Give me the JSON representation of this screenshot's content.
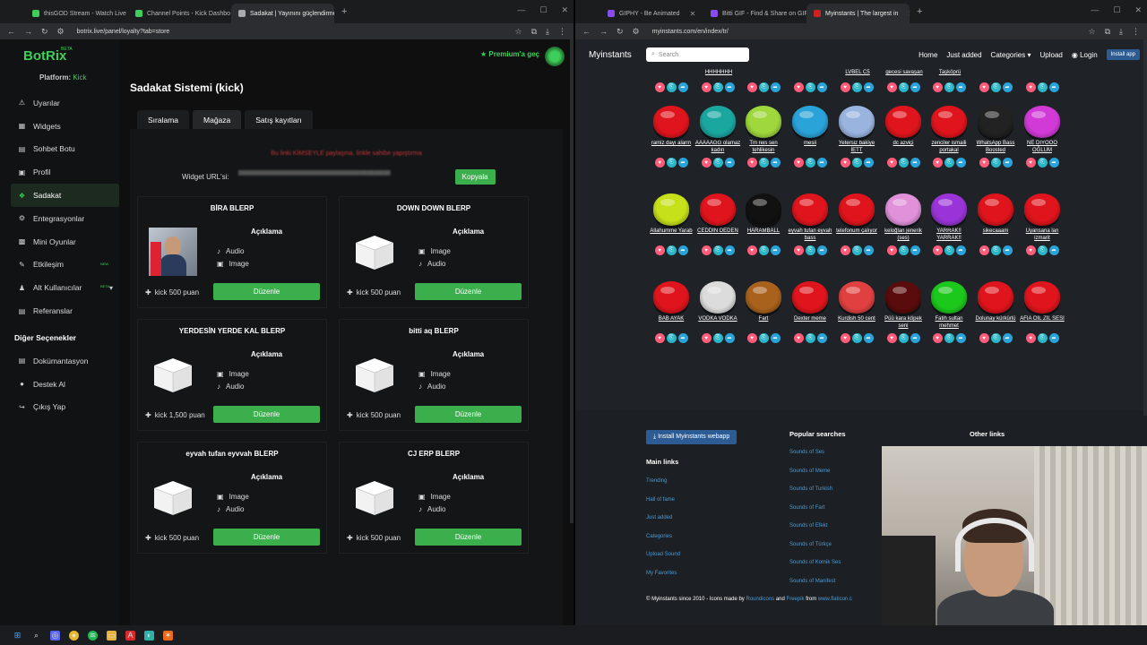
{
  "left_browser": {
    "tabs": [
      {
        "label": "thisGOD Stream - Watch Live o",
        "icon_color": "#3ecf5a"
      },
      {
        "label": "Channel Points - Kick Dashbo",
        "icon_color": "#3ecf5a"
      },
      {
        "label": "Sadakat | Yayınını güçlendirme",
        "icon_color": "#aaaaaa"
      }
    ],
    "url": "botrix.live/panel/loyalty?tab=store"
  },
  "right_browser": {
    "tabs": [
      {
        "label": "GIPHY - Be Animated",
        "icon_color": "#8a4cf0"
      },
      {
        "label": "Bitti GIF - Find & Share on GIF",
        "icon_color": "#8a4cf0"
      },
      {
        "label": "Myinstants | The largest in",
        "icon_color": "#cc2222"
      }
    ],
    "url": "myinstants.com/en/index/tr/"
  },
  "botrix": {
    "logo": "BotRix",
    "beta": "BETA",
    "platform_label": "Platform:",
    "platform_value": "Kick",
    "premium": "Premium'a geç",
    "nav": [
      {
        "label": "Uyarılar",
        "icon": "warning-icon"
      },
      {
        "label": "Widgets",
        "icon": "widgets-icon"
      },
      {
        "label": "Sohbet Botu",
        "icon": "chat-icon"
      },
      {
        "label": "Profil",
        "icon": "profile-icon"
      },
      {
        "label": "Sadakat",
        "icon": "loyalty-icon",
        "active": true
      },
      {
        "label": "Entegrasyonlar",
        "icon": "integrations-icon"
      },
      {
        "label": "Mini Oyunlar",
        "icon": "games-icon"
      },
      {
        "label": "Etkileşim",
        "icon": "interaction-icon",
        "badge": "NEW"
      },
      {
        "label": "Alt Kullanıcılar",
        "icon": "subusers-icon",
        "badge": "BETA"
      },
      {
        "label": "Referanslar",
        "icon": "referrals-icon"
      }
    ],
    "other_head": "Diğer Seçenekler",
    "other": [
      {
        "label": "Dokümantasyon",
        "icon": "docs-icon"
      },
      {
        "label": "Destek Al",
        "icon": "support-icon"
      },
      {
        "label": "Çıkış Yap",
        "icon": "logout-icon"
      }
    ],
    "title": "Sadakat Sistemi (kick)",
    "tabs": [
      "Sıralama",
      "Mağaza",
      "Satış kayıtları"
    ],
    "active_tab": "Mağaza",
    "warning": "Bu linki KİMSEYLE paylaşma, linkle sahibe yapıştırma",
    "widget_label": "Widget URL'si:",
    "copy_button": "Kopyala",
    "cards": [
      {
        "title": "BİRA BLERP",
        "desc": "Açıklama",
        "items": [
          "Audio",
          "Image"
        ],
        "price": "kick 500 puan",
        "button": "Düzenle",
        "thumb": "photo"
      },
      {
        "title": "DOWN DOWN BLERP",
        "desc": "Açıklama",
        "items": [
          "Image",
          "Audio"
        ],
        "price": "kick 500 puan",
        "button": "Düzenle",
        "thumb": "box"
      },
      {
        "title": "YERDESİN YERDE KAL BLERP",
        "desc": "Açıklama",
        "items": [
          "Image",
          "Audio"
        ],
        "price": "kick 1,500 puan",
        "button": "Düzenle",
        "thumb": "box"
      },
      {
        "title": "bitti aq BLERP",
        "desc": "Açıklama",
        "items": [
          "Image",
          "Audio"
        ],
        "price": "kick 500 puan",
        "button": "Düzenle",
        "thumb": "box"
      },
      {
        "title": "eyvah tufan eyvvah BLERP",
        "desc": "Açıklama",
        "items": [
          "Image",
          "Audio"
        ],
        "price": "kick 500 puan",
        "button": "Düzenle",
        "thumb": "box"
      },
      {
        "title": "CJ ERP BLERP",
        "desc": "Açıklama",
        "items": [
          "Image",
          "Audio"
        ],
        "price": "kick 500 puan",
        "button": "Düzenle",
        "thumb": "box"
      }
    ]
  },
  "myinstants": {
    "logo": "Myinstants",
    "search_placeholder": "Search",
    "nav": [
      "Home",
      "Just added",
      "Categories",
      "Upload",
      "Login"
    ],
    "install_app": "Install app",
    "top_row_names": [
      "HHHHHHH",
      "LVBEL C5",
      "gecesi savaşan",
      "Taşköprü"
    ],
    "rows": [
      [
        {
          "name": "ramiz dayı alarm",
          "color": "#e0141c"
        },
        {
          "name": "AAAAAĞĞ olamaz kadın",
          "color": "#1aa7a0"
        },
        {
          "name": "Tm reis sen tehlikesin",
          "color": "#9fd83c"
        },
        {
          "name": "mesii",
          "color": "#2aa3d8"
        },
        {
          "name": "Yetersiz bakiye İETT",
          "color": "#9ab4e0"
        },
        {
          "name": "dc azviçi",
          "color": "#e0141c"
        },
        {
          "name": "zenciler ismaili portakal",
          "color": "#e0141c"
        },
        {
          "name": "WhatsApp Bass Boosted",
          "color": "#222222"
        },
        {
          "name": "NE DİYOOO OĞLUM",
          "color": "#d23ad8"
        }
      ],
      [
        {
          "name": "Allahumme Yarab",
          "color": "#c6e01a"
        },
        {
          "name": "CEDDİN DEDEN",
          "color": "#e0141c"
        },
        {
          "name": "HARAMBALL",
          "color": "#111111"
        },
        {
          "name": "eyvah tufan eyvah bass",
          "color": "#e0141c"
        },
        {
          "name": "telefonum çalıyor",
          "color": "#e0141c"
        },
        {
          "name": "keloğlan jenerik (ses)",
          "color": "#e091d9"
        },
        {
          "name": "YARRAK!! YARRAK!!",
          "color": "#9a34d8"
        },
        {
          "name": "sikecaaam",
          "color": "#e0141c"
        },
        {
          "name": "Uyansana lan izmarit",
          "color": "#e0141c"
        }
      ],
      [
        {
          "name": "BAB AYAK",
          "color": "#e0141c"
        },
        {
          "name": "VODKA VODKA",
          "color": "#dcdcdc"
        },
        {
          "name": "Fart",
          "color": "#a8621c"
        },
        {
          "name": "Dexter meme",
          "color": "#e0141c"
        },
        {
          "name": "Kurdish 50 cent",
          "color": "#e04040"
        },
        {
          "name": "Püü kara köpek seni",
          "color": "#5a0b0b"
        },
        {
          "name": "Fatih sultan mehmet",
          "color": "#1cc81c"
        },
        {
          "name": "Dolunay kürkürlü",
          "color": "#e0141c"
        },
        {
          "name": "AFIA OİL ZİL SESİ",
          "color": "#e0141c"
        }
      ]
    ],
    "footer": {
      "install_button": "Install Myinstants webapp",
      "main_links_head": "Main links",
      "main_links": [
        "Trending",
        "Hall of fame",
        "Just added",
        "Categories",
        "Upload Sound",
        "My Favorites"
      ],
      "popular_head": "Popular searches",
      "popular": [
        "Sounds of Ses",
        "Sounds of Meme",
        "Sounds of Turkish",
        "Sounds of Fart",
        "Sounds of Efekt",
        "Sounds of Türkçe",
        "Sounds of Komik Ses",
        "Sounds of Manifest"
      ],
      "other_head": "Other links",
      "copyright": "© Myinstants since 2010 - Icons made by",
      "credit_a": "Roundicons",
      "credit_and": "and",
      "credit_b": "Freepik",
      "credit_from": "from",
      "credit_c": "www.flaticon.c"
    }
  }
}
